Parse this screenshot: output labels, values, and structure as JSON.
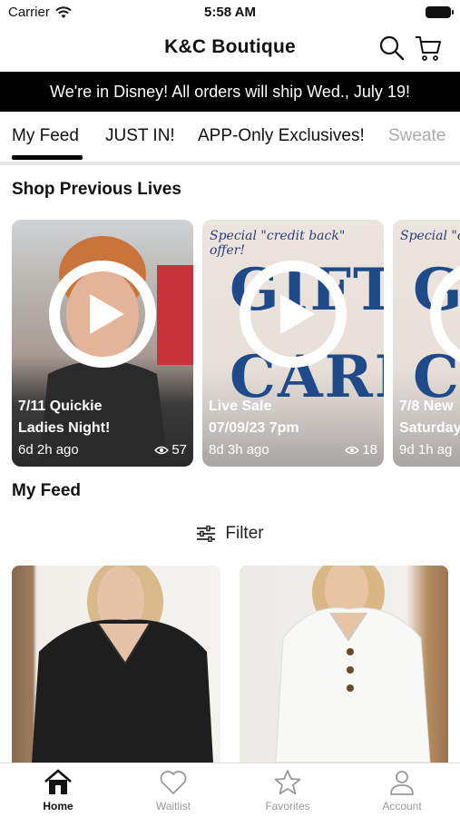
{
  "status_bar": {
    "carrier": "Carrier",
    "time": "5:58 AM"
  },
  "header": {
    "title": "K&C Boutique"
  },
  "banner": {
    "text": "We're in Disney! All orders will ship Wed., July 19!"
  },
  "tabs": [
    {
      "label": "My Feed",
      "active": true
    },
    {
      "label": "JUST IN!"
    },
    {
      "label": "APP-Only Exclusives!"
    },
    {
      "label": "Sweate"
    }
  ],
  "lives": {
    "title": "Shop Previous Lives",
    "cards": [
      {
        "line1": "7/11 Quickie",
        "line2": "Ladies Night!",
        "ago": "6d 2h ago",
        "views": "57"
      },
      {
        "line1": "Live Sale",
        "line2": "07/09/23 7pm",
        "ago": "8d 3h ago",
        "views": "18",
        "promo": "Special \"credit back\" offer!",
        "gift_line1": "GIFT",
        "gift_line2": "CARD"
      },
      {
        "line1": "7/8 New",
        "line2": "Saturday",
        "ago": "9d 1h ag",
        "promo": "Special \"credit b",
        "gift_line1": "G",
        "gift_line2": "C"
      }
    ]
  },
  "feed": {
    "title": "My Feed",
    "filter_label": "Filter"
  },
  "tab_bar": [
    {
      "label": "Home",
      "icon": "home-icon",
      "active": true
    },
    {
      "label": "Waitlist",
      "icon": "heart-icon"
    },
    {
      "label": "Favorites",
      "icon": "star-icon"
    },
    {
      "label": "Account",
      "icon": "person-icon"
    }
  ]
}
